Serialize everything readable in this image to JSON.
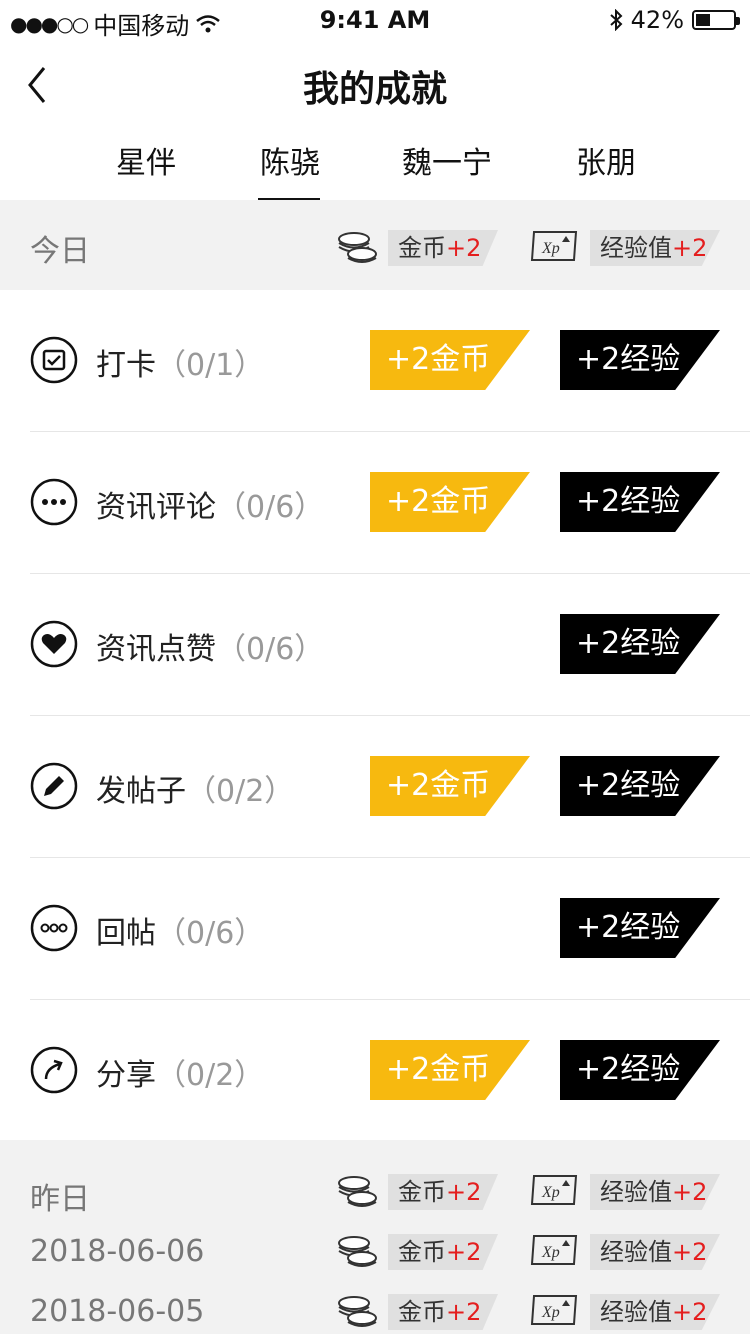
{
  "status_bar": {
    "carrier": "中国移动",
    "time": "9:41 AM",
    "battery": "42%"
  },
  "header": {
    "title": "我的成就"
  },
  "tabs": [
    {
      "label": "星伴",
      "active": false
    },
    {
      "label": "陈骁",
      "active": true
    },
    {
      "label": "魏一宁",
      "active": false
    },
    {
      "label": "张朋",
      "active": false
    }
  ],
  "today": {
    "label": "今日",
    "coin_label": "金币",
    "coin_plus": "+2",
    "xp_label": "经验值",
    "xp_plus": "+2"
  },
  "tasks": [
    {
      "icon": "calendar-check-icon",
      "name": "打卡",
      "progress": "（0/1）",
      "coin_badge": "+2金币",
      "xp_badge": "+2经验"
    },
    {
      "icon": "comment-icon",
      "name": "资讯评论",
      "progress": "（0/6）",
      "coin_badge": "+2金币",
      "xp_badge": "+2经验"
    },
    {
      "icon": "heart-icon",
      "name": "资讯点赞",
      "progress": "（0/6）",
      "coin_badge": "",
      "xp_badge": "+2经验"
    },
    {
      "icon": "pencil-icon",
      "name": "发帖子",
      "progress": "（0/2）",
      "coin_badge": "+2金币",
      "xp_badge": "+2经验"
    },
    {
      "icon": "reply-icon",
      "name": "回帖",
      "progress": "（0/6）",
      "coin_badge": "",
      "xp_badge": "+2经验"
    },
    {
      "icon": "share-icon",
      "name": "分享",
      "progress": "（0/2）",
      "coin_badge": "+2金币",
      "xp_badge": "+2经验"
    }
  ],
  "history": [
    {
      "label": "昨日",
      "coin_label": "金币",
      "coin_plus": "+2",
      "xp_label": "经验值",
      "xp_plus": "+2"
    },
    {
      "label": "2018-06-06",
      "coin_label": "金币",
      "coin_plus": "+2",
      "xp_label": "经验值",
      "xp_plus": "+2"
    },
    {
      "label": "2018-06-05",
      "coin_label": "金币",
      "coin_plus": "+2",
      "xp_label": "经验值",
      "xp_plus": "+2"
    }
  ],
  "colors": {
    "coin_badge": "#f7b90f",
    "xp_badge": "#000000",
    "plus_red": "#e41e1e",
    "section_bg": "#f2f2f2"
  }
}
